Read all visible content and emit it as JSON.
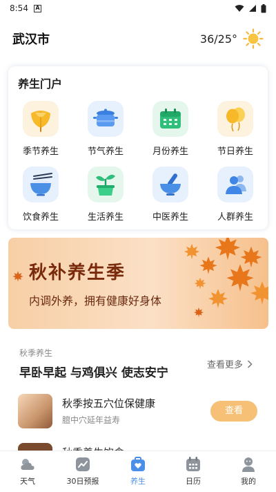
{
  "status_bar": {
    "time": "8:54"
  },
  "header": {
    "city": "武汉市",
    "temperature": "36/25°"
  },
  "portal": {
    "title": "养生门户",
    "items": [
      {
        "label": "季节养生",
        "icon": "ginkgo-leaf-icon"
      },
      {
        "label": "节气养生",
        "icon": "cooking-pot-icon"
      },
      {
        "label": "月份养生",
        "icon": "calendar-icon"
      },
      {
        "label": "节日养生",
        "icon": "balloon-icon"
      },
      {
        "label": "饮食养生",
        "icon": "rice-bowl-icon"
      },
      {
        "label": "生活养生",
        "icon": "sprout-icon"
      },
      {
        "label": "中医养生",
        "icon": "mortar-pestle-icon"
      },
      {
        "label": "人群养生",
        "icon": "people-icon"
      }
    ]
  },
  "banner": {
    "title": "秋补养生季",
    "subtitle": "内调外养，拥有健康好身体"
  },
  "section": {
    "tag": "秋季养生",
    "headline": "早卧早起 与鸡俱兴 使志安宁",
    "more_label": "查看更多"
  },
  "articles": [
    {
      "title": "秋季按五穴位保健康",
      "subtitle": "膻中穴延年益寿",
      "button_label": "查看"
    }
  ],
  "peek_article": {
    "title": "秋季养生饮食..."
  },
  "tabbar": {
    "tabs": [
      {
        "label": "天气",
        "icon": "cloud-sun-icon"
      },
      {
        "label": "30日预报",
        "icon": "trend-chart-icon"
      },
      {
        "label": "养生",
        "icon": "health-bag-icon",
        "active": true
      },
      {
        "label": "日历",
        "icon": "calendar-icon"
      },
      {
        "label": "我的",
        "icon": "person-icon"
      }
    ]
  },
  "colors": {
    "accent_blue": "#4b8fe8",
    "button_orange": "#f6c176",
    "banner_text": "#7a2a0c"
  }
}
